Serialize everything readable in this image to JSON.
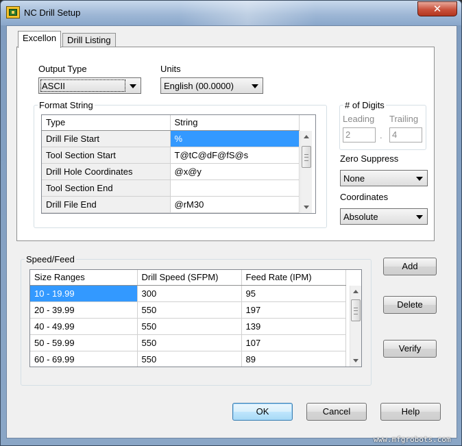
{
  "window": {
    "title": "NC Drill Setup",
    "close_glyph": "✕"
  },
  "tabs": [
    {
      "label": "Excellon",
      "active": true
    },
    {
      "label": "Drill Listing",
      "active": false
    }
  ],
  "excellon": {
    "output_type": {
      "label": "Output Type",
      "value": "ASCII"
    },
    "units": {
      "label": "Units",
      "value": "English (00.0000)"
    },
    "format_string": {
      "title": "Format String",
      "columns": [
        "Type",
        "String"
      ],
      "rows": [
        {
          "type": "Drill File Start",
          "string": "%",
          "selected": true
        },
        {
          "type": "Tool Section Start",
          "string": "T@tC@dF@fS@s"
        },
        {
          "type": "Drill Hole Coordinates",
          "string": "@x@y"
        },
        {
          "type": "Tool Section End",
          "string": ""
        },
        {
          "type": "Drill File End",
          "string": "@rM30"
        }
      ]
    },
    "digits": {
      "title": "# of Digits",
      "leading_label": "Leading",
      "trailing_label": "Trailing",
      "leading_value": "2",
      "trailing_value": "4",
      "separator": "."
    },
    "zero_suppress": {
      "label": "Zero Suppress",
      "value": "None"
    },
    "coordinates": {
      "label": "Coordinates",
      "value": "Absolute"
    }
  },
  "speed_feed": {
    "title": "Speed/Feed",
    "columns": [
      "Size Ranges",
      "Drill Speed (SFPM)",
      "Feed Rate (IPM)"
    ],
    "rows": [
      {
        "size": "10 - 19.99",
        "speed": "300",
        "feed": "95",
        "selected": true
      },
      {
        "size": "20 - 39.99",
        "speed": "550",
        "feed": "197"
      },
      {
        "size": "40 - 49.99",
        "speed": "550",
        "feed": "139"
      },
      {
        "size": "50 - 59.99",
        "speed": "550",
        "feed": "107"
      },
      {
        "size": "60 - 69.99",
        "speed": "550",
        "feed": "89"
      }
    ],
    "buttons": {
      "add": "Add",
      "delete": "Delete",
      "verify": "Verify"
    }
  },
  "footer": {
    "ok": "OK",
    "cancel": "Cancel",
    "help": "Help"
  },
  "watermark": "www.mfgrobots.com",
  "colors": {
    "selection": "#3399ff",
    "dialog_bg": "#f0f0f0",
    "title_bar": "#9fb8d6"
  }
}
